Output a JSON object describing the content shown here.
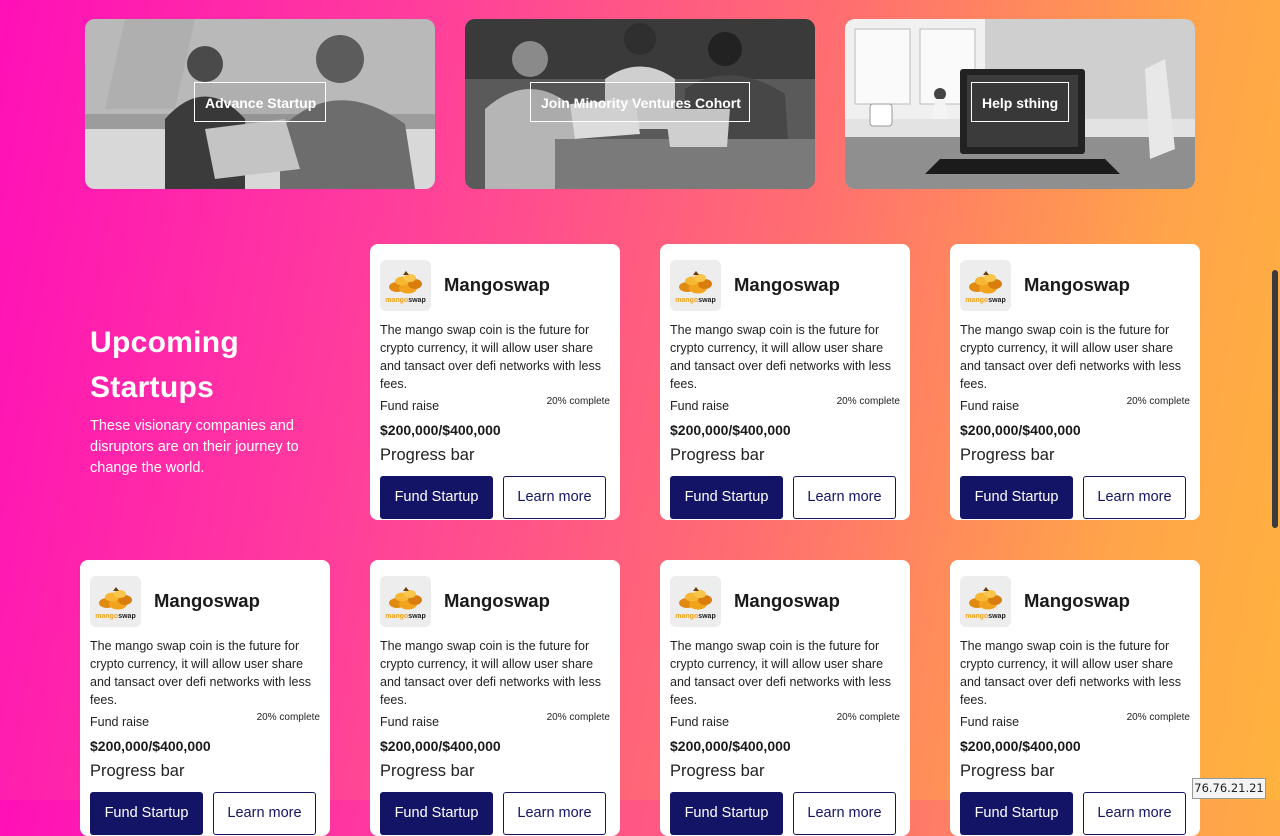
{
  "hero": [
    {
      "label": "Advance Startup"
    },
    {
      "label": "Join Minority Ventures Cohort"
    },
    {
      "label": "Help sthing"
    }
  ],
  "intro": {
    "title_line1": "Upcoming",
    "title_line2": "Startups",
    "subtitle": "These visionary companies and disruptors are on their journey to change the world."
  },
  "cards": [
    {
      "name": "Mangoswap",
      "logo_text_a": "mango",
      "logo_text_b": "swap",
      "description": "The mango swap coin is the future for crypto currency, it will allow user share and tansact over defi networks with less fees.",
      "fund_label": "Fund raise",
      "percent": "20% complete",
      "amount": "$200,000/$400,000",
      "progress_label": "Progress bar",
      "fund_button": "Fund Startup",
      "learn_button": "Learn more"
    },
    {
      "name": "Mangoswap",
      "logo_text_a": "mango",
      "logo_text_b": "swap",
      "description": "The mango swap coin is the future for crypto currency, it will allow user share and tansact over defi networks with less fees.",
      "fund_label": "Fund raise",
      "percent": "20% complete",
      "amount": "$200,000/$400,000",
      "progress_label": "Progress bar",
      "fund_button": "Fund Startup",
      "learn_button": "Learn more"
    },
    {
      "name": "Mangoswap",
      "logo_text_a": "mango",
      "logo_text_b": "swap",
      "description": "The mango swap coin is the future for crypto currency, it will allow user share and tansact over defi networks with less fees.",
      "fund_label": "Fund raise",
      "percent": "20% complete",
      "amount": "$200,000/$400,000",
      "progress_label": "Progress bar",
      "fund_button": "Fund Startup",
      "learn_button": "Learn more"
    },
    {
      "name": "Mangoswap",
      "logo_text_a": "mango",
      "logo_text_b": "swap",
      "description": "The mango swap coin is the future for crypto currency, it will allow user share and tansact over defi networks with less fees.",
      "fund_label": "Fund raise",
      "percent": "20% complete",
      "amount": "$200,000/$400,000",
      "progress_label": "Progress bar",
      "fund_button": "Fund Startup",
      "learn_button": "Learn more"
    },
    {
      "name": "Mangoswap",
      "logo_text_a": "mango",
      "logo_text_b": "swap",
      "description": "The mango swap coin is the future for crypto currency, it will allow user share and tansact over defi networks with less fees.",
      "fund_label": "Fund raise",
      "percent": "20% complete",
      "amount": "$200,000/$400,000",
      "progress_label": "Progress bar",
      "fund_button": "Fund Startup",
      "learn_button": "Learn more"
    },
    {
      "name": "Mangoswap",
      "logo_text_a": "mango",
      "logo_text_b": "swap",
      "description": "The mango swap coin is the future for crypto currency, it will allow user share and tansact over defi networks with less fees.",
      "fund_label": "Fund raise",
      "percent": "20% complete",
      "amount": "$200,000/$400,000",
      "progress_label": "Progress bar",
      "fund_button": "Fund Startup",
      "learn_button": "Learn more"
    },
    {
      "name": "Mangoswap",
      "logo_text_a": "mango",
      "logo_text_b": "swap",
      "description": "The mango swap coin is the future for crypto currency, it will allow user share and tansact over defi networks with less fees.",
      "fund_label": "Fund raise",
      "percent": "20% complete",
      "amount": "$200,000/$400,000",
      "progress_label": "Progress bar",
      "fund_button": "Fund Startup",
      "learn_button": "Learn more"
    }
  ],
  "ip_badge": "76.76.21.21",
  "colors": {
    "button_primary": "#141466",
    "brand_mango": "#f2a31c"
  }
}
